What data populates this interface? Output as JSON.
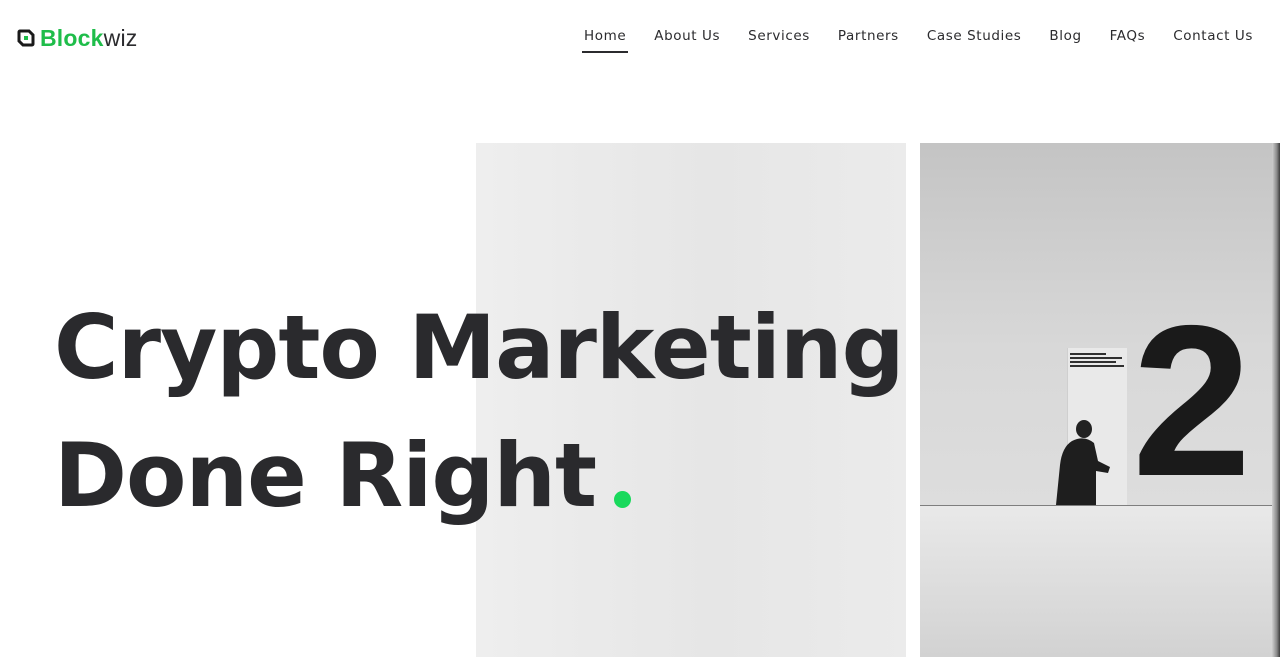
{
  "brand": {
    "name_part1": "Block",
    "name_part2": "wiz",
    "logo_icon": "blockwiz-logo-icon",
    "accent_color": "#1fbd4a"
  },
  "nav": {
    "items": [
      {
        "label": "Home",
        "active": true
      },
      {
        "label": "About Us"
      },
      {
        "label": "Services"
      },
      {
        "label": "Partners"
      },
      {
        "label": "Case Studies"
      },
      {
        "label": "Blog"
      },
      {
        "label": "FAQs"
      },
      {
        "label": "Contact Us"
      }
    ]
  },
  "hero": {
    "headline_line1": "Crypto Marketing",
    "headline_line2": "Done Right",
    "dot_color": "#19d95c",
    "image_left": "gray-wall-photo",
    "image_right": "gallery-number-2-photo",
    "image_right_number": "2"
  }
}
